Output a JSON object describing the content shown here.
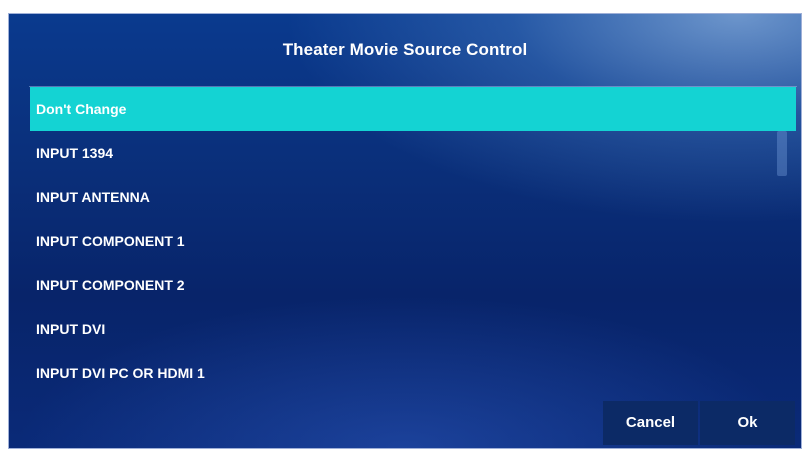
{
  "dialog": {
    "title": "Theater Movie Source Control",
    "selected_index": 0,
    "items": [
      {
        "label": "Don't Change"
      },
      {
        "label": "INPUT 1394"
      },
      {
        "label": "INPUT ANTENNA"
      },
      {
        "label": "INPUT COMPONENT 1"
      },
      {
        "label": "INPUT COMPONENT 2"
      },
      {
        "label": "INPUT DVI"
      },
      {
        "label": "INPUT DVI PC OR HDMI 1"
      }
    ],
    "cancel_label": "Cancel",
    "ok_label": "Ok"
  },
  "colors": {
    "selection": "#14d3d3",
    "background": "#0a2f7a",
    "button": "#0c2a66",
    "text": "#ffffff"
  }
}
